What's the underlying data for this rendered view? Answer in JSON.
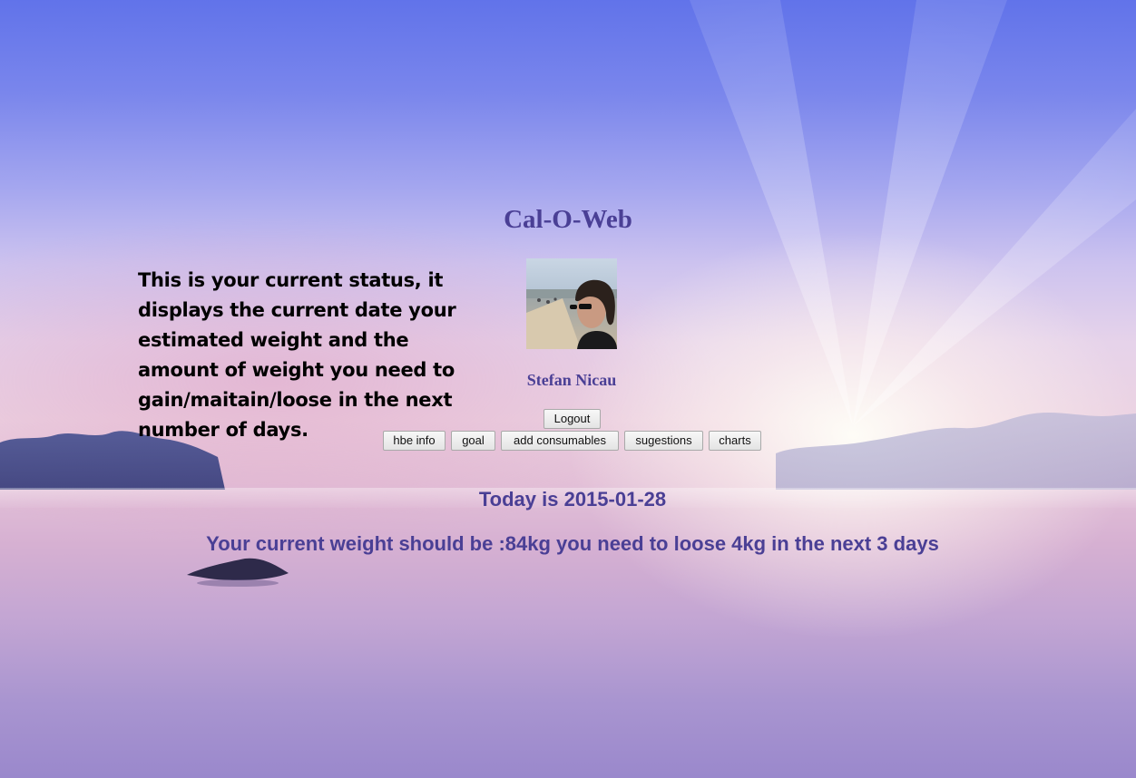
{
  "app": {
    "title": "Cal-O-Web"
  },
  "user": {
    "name": "Stefan Nicau",
    "avatar_icon": "user-avatar-photo"
  },
  "nav": {
    "logout_label": "Logout",
    "buttons": [
      {
        "label": "hbe info"
      },
      {
        "label": "goal"
      },
      {
        "label": "add consumables"
      },
      {
        "label": "sugestions"
      },
      {
        "label": "charts"
      }
    ]
  },
  "help": {
    "text": "This is your current status, it displays the current date your estimated weight and the amount of weight you need to gain/maitain/loose in the next number of days."
  },
  "status": {
    "today_text": "Today is 2015-01-28",
    "weight_text": "Your current weight should be :84kg you need to loose 4kg in the next 3 days"
  },
  "colors": {
    "accent": "#4a3f95"
  }
}
